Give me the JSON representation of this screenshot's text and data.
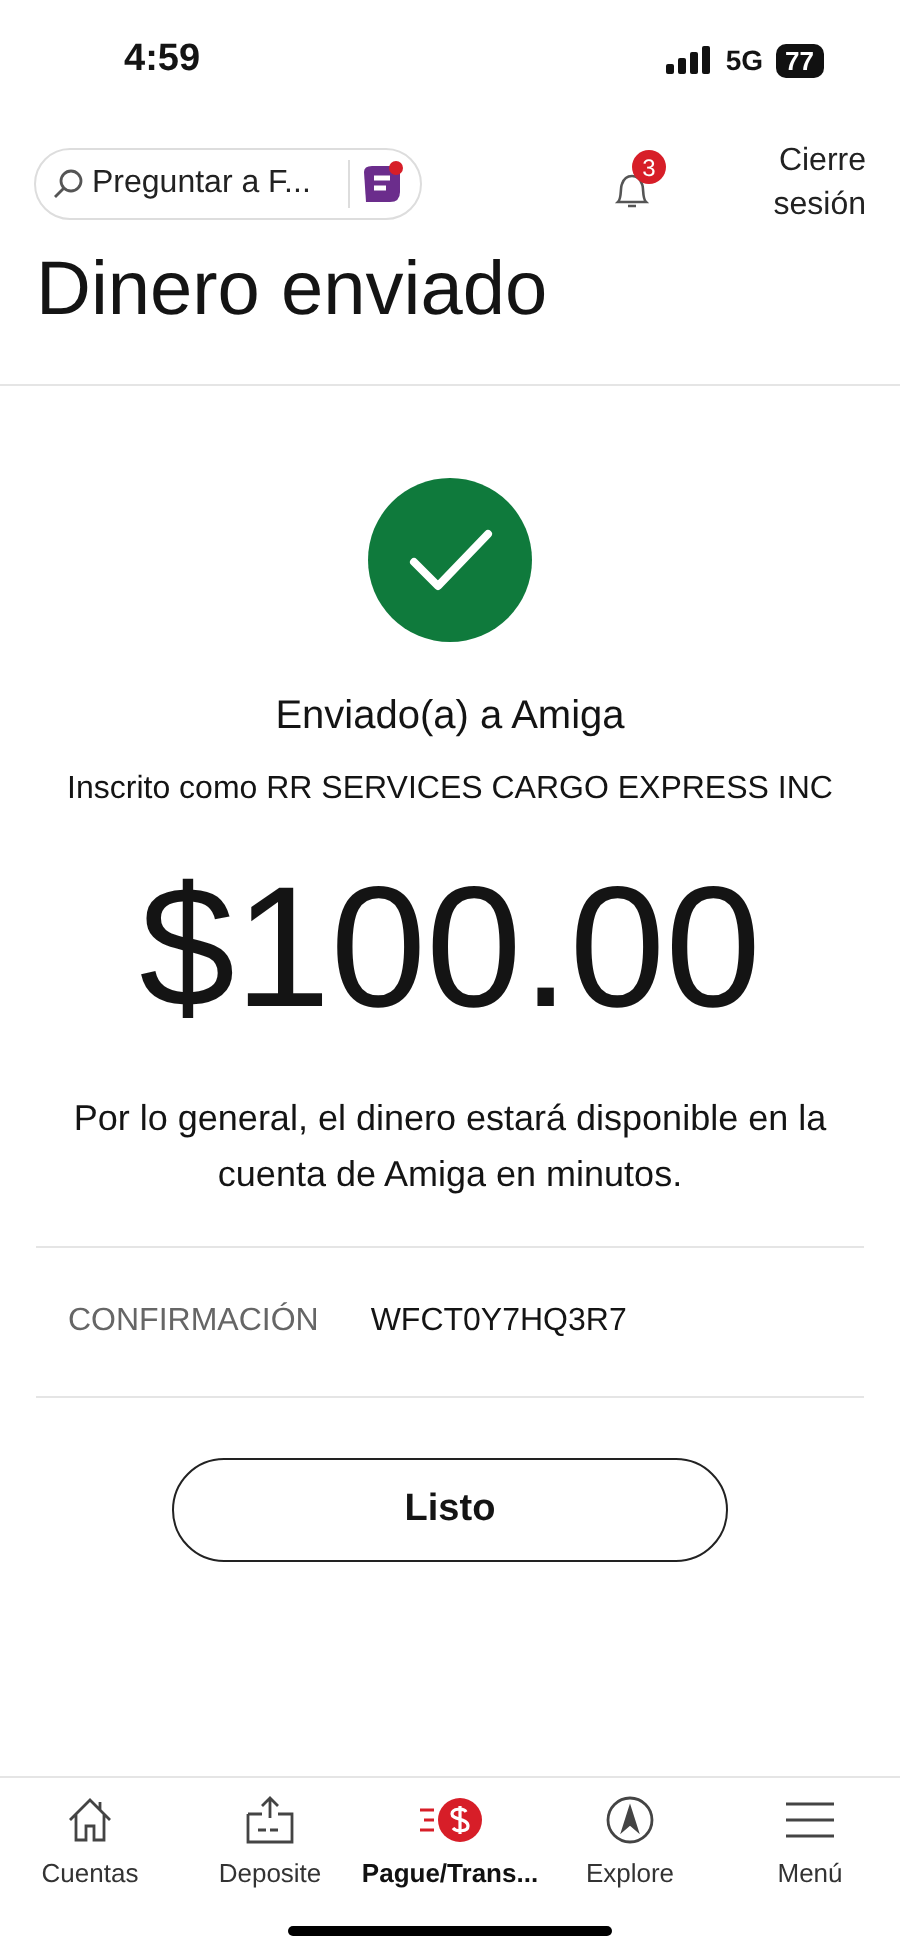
{
  "status_bar": {
    "time": "4:59",
    "network": "5G",
    "battery": "77"
  },
  "header": {
    "search": {
      "placeholder": "Preguntar a F..."
    },
    "notifications": {
      "count": "3"
    },
    "logout": "Cierre sesión"
  },
  "title": "Dinero enviado",
  "confirmation": {
    "recipient": "Enviado(a) a Amiga",
    "enrolled": "Inscrito como RR SERVICES CARGO EXPRESS INC",
    "amount": "$100.00",
    "message": "Por lo general, el dinero estará disponible en la cuenta de Amiga en minutos.",
    "number_label": "CONFIRMACIÓN",
    "number": "WFCT0Y7HQ3R7"
  },
  "done_button": "Listo",
  "bottom_nav": [
    {
      "kind": "home",
      "label": "Cuentas",
      "selected": false
    },
    {
      "kind": "deposit",
      "label": "Deposite",
      "selected": false
    },
    {
      "kind": "pay",
      "label": "Pague/Trans...",
      "selected": true
    },
    {
      "kind": "explore",
      "label": "Explore",
      "selected": false
    },
    {
      "kind": "menu",
      "label": "Menú",
      "selected": false
    }
  ]
}
